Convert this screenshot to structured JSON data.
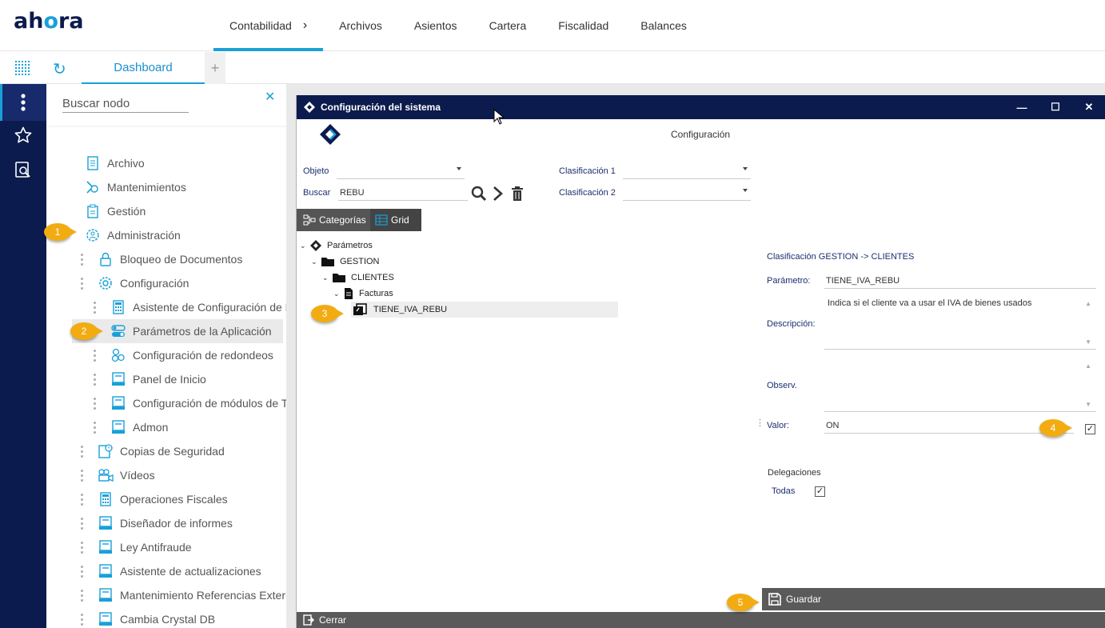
{
  "app": {
    "logo": "ahora"
  },
  "topnav": [
    {
      "label": "Contabilidad",
      "active": true
    },
    {
      "label": "Archivos"
    },
    {
      "label": "Asientos"
    },
    {
      "label": "Cartera"
    },
    {
      "label": "Fiscalidad"
    },
    {
      "label": "Balances"
    }
  ],
  "tabs": {
    "dashboard": "Dashboard",
    "add": "+"
  },
  "sidebar": {
    "search_placeholder": "Buscar nodo",
    "items": [
      {
        "label": "Archivo",
        "icon": "document-icon"
      },
      {
        "label": "Mantenimientos",
        "icon": "tools-icon"
      },
      {
        "label": "Gestión",
        "icon": "clipboard-icon"
      },
      {
        "label": "Administración",
        "icon": "admin-icon"
      },
      {
        "label": "Bloqueo de Documentos",
        "icon": "lock-icon"
      },
      {
        "label": "Configuración",
        "icon": "gear-icon"
      },
      {
        "label": "Asistente de Configuración de Er",
        "icon": "calculator-icon"
      },
      {
        "label": "Parámetros de la Aplicación",
        "icon": "toggle-icon"
      },
      {
        "label": "Configuración de redondeos",
        "icon": "coins-icon"
      },
      {
        "label": "Panel de Inicio",
        "icon": "form-icon"
      },
      {
        "label": "Configuración de módulos de Tec",
        "icon": "form-icon"
      },
      {
        "label": "Admon",
        "icon": "form-icon"
      },
      {
        "label": "Copias de Seguridad",
        "icon": "backup-icon"
      },
      {
        "label": "Vídeos",
        "icon": "video-icon"
      },
      {
        "label": "Operaciones Fiscales",
        "icon": "calculator-icon"
      },
      {
        "label": "Diseñador de informes",
        "icon": "form-icon"
      },
      {
        "label": "Ley Antifraude",
        "icon": "form-icon"
      },
      {
        "label": "Asistente de actualizaciones",
        "icon": "form-icon"
      },
      {
        "label": "Mantenimiento Referencias Externa",
        "icon": "form-icon"
      },
      {
        "label": "Cambia Crystal DB",
        "icon": "form-icon"
      }
    ]
  },
  "dialog": {
    "title": "Configuración del sistema",
    "subtitle": "Configuración",
    "window_buttons": [
      "—",
      "☐",
      "✕"
    ],
    "objeto_label": "Objeto",
    "objeto_value": "",
    "buscar_label": "Buscar",
    "buscar_value": "REBU",
    "clasif1_label": "Clasificación 1",
    "clasif1_value": "",
    "clasif2_label": "Clasificación 2",
    "clasif2_value": "",
    "view_tabs": {
      "categorias": "Categorías",
      "grid": "Grid"
    },
    "tree": [
      {
        "label": "Parámetros"
      },
      {
        "label": "GESTION"
      },
      {
        "label": "CLIENTES"
      },
      {
        "label": "Facturas"
      },
      {
        "label": "TIENE_IVA_REBU",
        "selected": true
      }
    ],
    "detail": {
      "heading": "Clasificación GESTION -> CLIENTES",
      "parametro_label": "Parámetro:",
      "parametro_value": "TIENE_IVA_REBU",
      "descripcion_label": "Descripción:",
      "descripcion_value": "Indica si el cliente va a usar el IVA de bienes usados",
      "observ_label": "Observ.",
      "observ_value": "",
      "valor_label": "Valor:",
      "valor_value": "ON",
      "valor_checked": true,
      "delegaciones_label": "Delegaciones",
      "todas_label": "Todas",
      "todas_checked": true
    },
    "guardar": "Guardar",
    "cerrar": "Cerrar"
  },
  "callouts": [
    "1",
    "2",
    "3",
    "4",
    "5"
  ],
  "colors": {
    "navy": "#0c1b4d",
    "accent": "#1aa0d8",
    "callout": "#f2ac12"
  }
}
